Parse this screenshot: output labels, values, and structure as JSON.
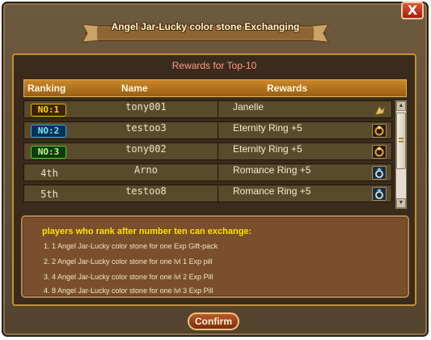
{
  "window": {
    "title": "Angel Jar-Lucky color stone Exchanging",
    "close_label": "X"
  },
  "panel": {
    "title": "Rewards for Top-10",
    "columns": [
      "Ranking",
      "Name",
      "Rewards"
    ]
  },
  "rows": [
    {
      "rank": "NO:1",
      "rank_style": "gold",
      "name": "tony001",
      "reward": "Janelle",
      "reward_icon": "wing-icon"
    },
    {
      "rank": "NO:2",
      "rank_style": "blue",
      "name": "testoo3",
      "reward": "Eternity Ring +5",
      "reward_icon": "ring-icon"
    },
    {
      "rank": "NO:3",
      "rank_style": "green",
      "name": "tony002",
      "reward": "Eternity Ring +5",
      "reward_icon": "ring-icon"
    },
    {
      "rank": "4th",
      "rank_style": "text",
      "name": "Arno",
      "reward": "Romance Ring +5",
      "reward_icon": "romance-ring-icon"
    },
    {
      "rank": "5th",
      "rank_style": "text",
      "name": "testoo8",
      "reward": "Romance Ring +5",
      "reward_icon": "romance-ring-icon"
    }
  ],
  "info": {
    "title": "players who rank after number ten can exchange:",
    "lines": [
      "1. 1 Angel Jar-Lucky color stone for one Exp Gift-pack",
      "2. 2 Angel Jar-Lucky color stone for one lvl 1 Exp pill",
      "3. 4 Angel Jar-Lucky color stone for one lvl 2 Exp Pill",
      "4. 8 Angel Jar-Lucky color stone for one lvl 3 Exp Pill"
    ]
  },
  "confirm_label": "Confirm",
  "colors": {
    "rank_gold": "#e8b400",
    "rank_blue": "#2aa7e8",
    "rank_green": "#4cc630",
    "accent_title": "#ff9a8c",
    "info_title": "#ffe200"
  }
}
